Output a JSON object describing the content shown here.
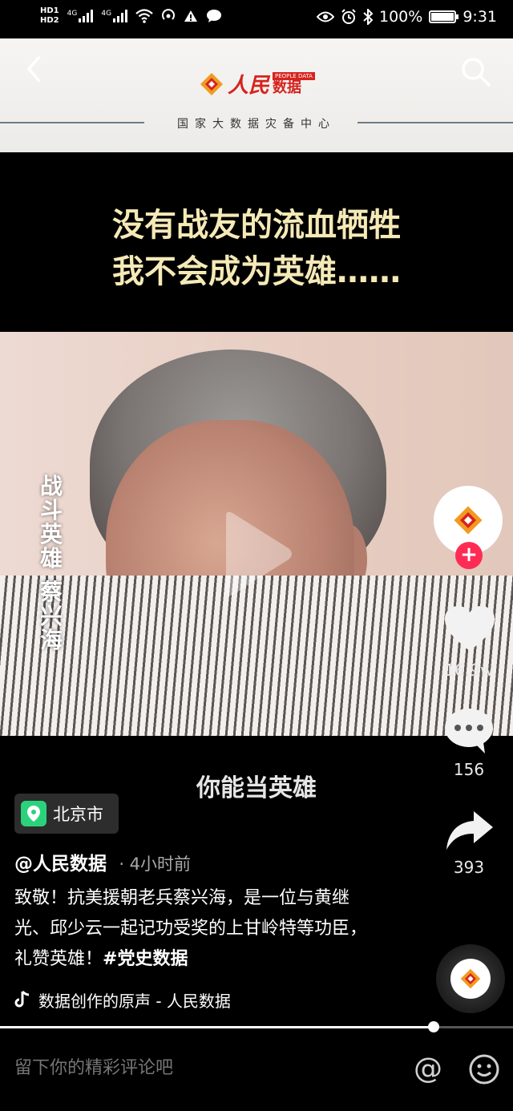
{
  "status_bar": {
    "sim_labels": [
      "HD1",
      "HD2",
      "4G",
      "4G"
    ],
    "battery_percent": "100%",
    "battery_level": 1.0,
    "time": "9:31"
  },
  "header": {
    "logo_text": "人民数据",
    "logo_en": "PEOPLE DATA",
    "logo_badge_cn": "数据",
    "logo_cn": "人民",
    "subtitle": "国家大数据灾备中心"
  },
  "video": {
    "top_caption_line1": "没有战友的流血牺牲",
    "top_caption_line2": "我不会成为英雄……",
    "vertical_caption_line1": "战斗英雄",
    "vertical_caption_line2": "蔡兴海",
    "subtitle": "你能当英雄"
  },
  "sidebar": {
    "likes": "16.9w",
    "comments": "156",
    "shares": "393",
    "follow_symbol": "+"
  },
  "post": {
    "location": "北京市",
    "author": "@人民数据",
    "time_ago": "· 4小时前",
    "description": "致敬！抗美援朝老兵蔡兴海，是一位与黄继光、邱少云一起记功受奖的上甘岭特等功臣，礼赞英雄！",
    "hashtag": "#党史数据",
    "music": "数据创作的原声 - 人民数据"
  },
  "progress": 0.845,
  "comment_bar": {
    "placeholder": "留下你的精彩评论吧",
    "at_symbol": "@"
  },
  "colors": {
    "accent_red": "#fe2c55",
    "brand_red": "#d6231e",
    "location_green": "#2bd27c",
    "caption_yellow": "#f5e9b6"
  }
}
